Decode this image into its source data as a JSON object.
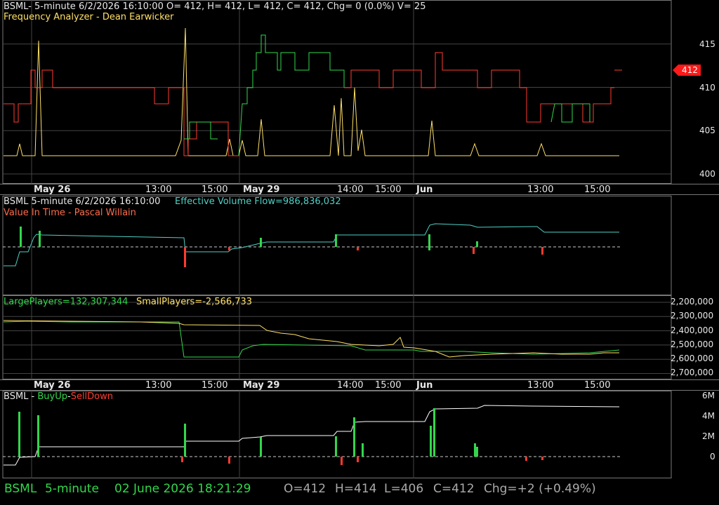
{
  "colors": {
    "green": "#32d74b",
    "red": "#ff3b30",
    "yellow": "#ffe066",
    "cyan": "#4fd1c5",
    "white": "#ffffff",
    "orange": "#ff6b4a",
    "grid": "#444444",
    "price_tag": "#ff1a1a"
  },
  "panel1": {
    "header": "BSML- 5-minute 6/2/2026 16:10:00 O= 412, H= 412, L= 412, C= 412, Chg= 0 (0.0%) V= 25",
    "indicator": "Frequency Analyzer - Dean Earwicker",
    "y_ticks": [
      "415",
      "410",
      "405",
      "400"
    ],
    "price_tag": "412",
    "price_levels": [
      415,
      410,
      405,
      400
    ],
    "last_price": 412
  },
  "xaxis1": {
    "labels": [
      "May 26",
      "13:00",
      "15:00",
      "May 29",
      "14:00",
      "15:00",
      "Jun",
      "13:00",
      "15:00"
    ]
  },
  "panel2": {
    "header_symbol": "BSML 5-minute  6/2/2026 16:10:00",
    "header_value": "Effective Volume Flow=986,836,032",
    "indicator": "Value In Time - Pascal Willain"
  },
  "panel3": {
    "large_players": "LargePlayers=132,307,344",
    "small_players": "SmallPlayers=-2,566,733",
    "y_ticks": [
      "2,200,000",
      "2,300,000",
      "2,400,000",
      "2,500,000",
      "2,600,000",
      "2,700,000"
    ]
  },
  "xaxis2": {
    "labels": [
      "May 26",
      "13:00",
      "15:00",
      "May 29",
      "14:00",
      "15:00",
      "Jun",
      "13:00",
      "15:00"
    ]
  },
  "panel4": {
    "symbol": "BSML - ",
    "buy": "BuyUp",
    "dash": "-",
    "sell": "SellDown",
    "y_ticks": [
      "6M",
      "4M",
      "2M",
      "0"
    ]
  },
  "status": {
    "symbol": "BSML",
    "interval": "5-minute",
    "datetime": "02 June 2026 18:21:29",
    "open": "O=412",
    "high": "H=414",
    "low": "L=406",
    "close": "C=412",
    "change": "Chg=+2 (+0.49%)"
  }
}
